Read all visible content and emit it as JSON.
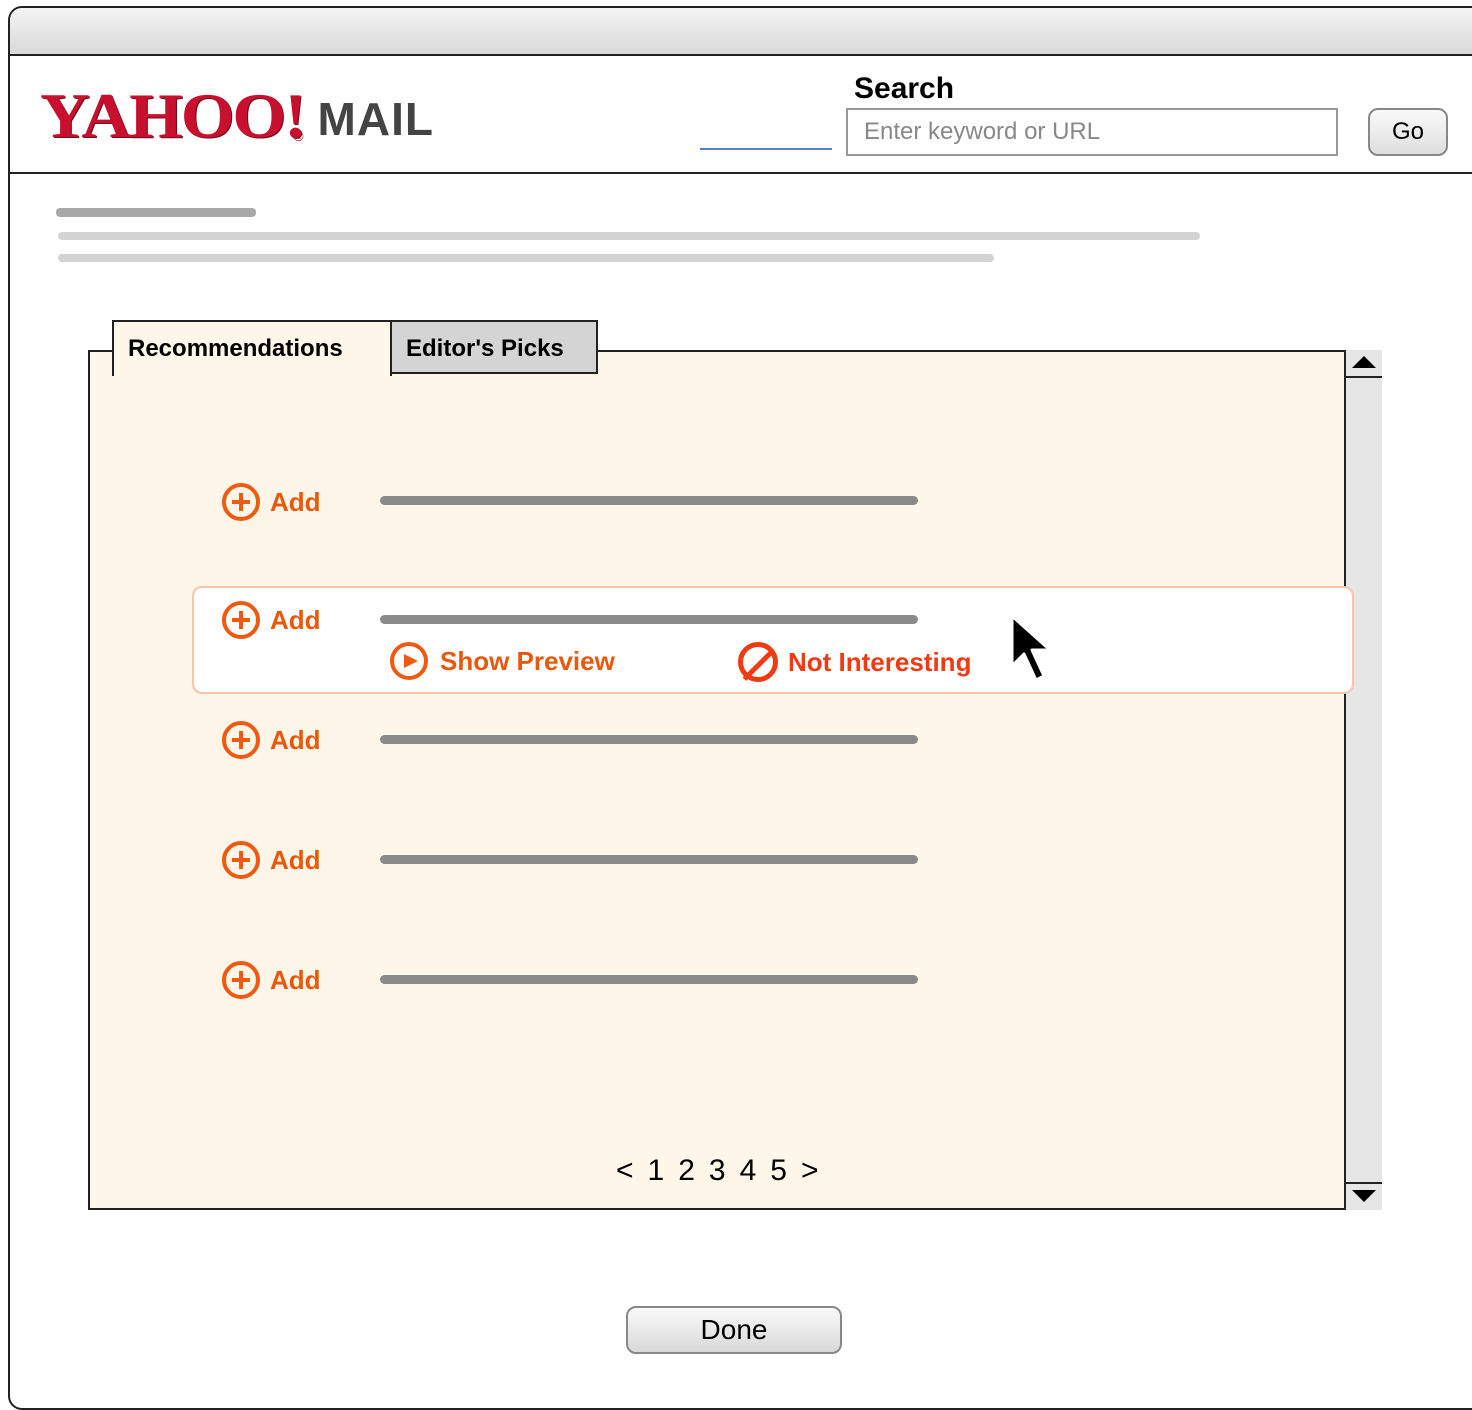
{
  "app": {
    "logo_text": "YAHOO!",
    "logo_mark": "®",
    "logo_product": "MAIL"
  },
  "search": {
    "label": "Search",
    "placeholder": "Enter keyword or URL",
    "go_label": "Go"
  },
  "tabs": [
    {
      "label": "Recommendations",
      "active": true
    },
    {
      "label": "Editor's Picks",
      "active": false
    }
  ],
  "items": [
    {
      "add_label": "Add"
    },
    {
      "add_label": "Add",
      "show_preview_label": "Show Preview",
      "not_interesting_label": "Not Interesting"
    },
    {
      "add_label": "Add"
    },
    {
      "add_label": "Add"
    },
    {
      "add_label": "Add"
    }
  ],
  "pagination": {
    "prev": "<",
    "pages": [
      "1",
      "2",
      "3",
      "4",
      "5"
    ],
    "next": ">"
  },
  "done_label": "Done",
  "icons": {
    "add": "plus-circle-icon",
    "preview": "play-circle-icon",
    "not_interesting": "prohibited-icon",
    "cursor": "mouse-pointer-icon"
  },
  "colors": {
    "accent": "#ef5a12",
    "panel_bg": "#fef6e8",
    "logo_red": "#c8102e"
  }
}
